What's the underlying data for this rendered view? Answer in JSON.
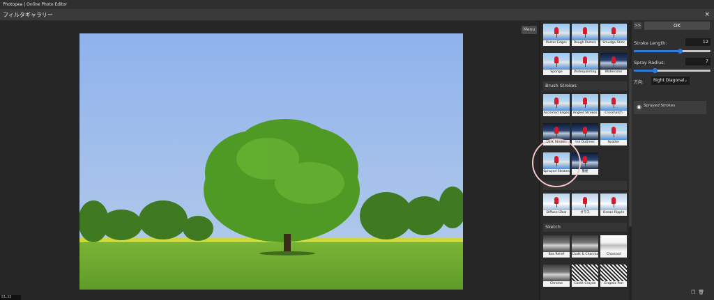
{
  "window": {
    "app_title": "Photopea | Online Photo Editor",
    "dialog_title": "フィルタギャラリー",
    "close_label": "×"
  },
  "preview": {
    "menu_label": "Menu",
    "status_text": "51.33"
  },
  "gallery": {
    "categories": [
      {
        "name": "",
        "items": [
          {
            "label": "Poster Edges",
            "style": "blue"
          },
          {
            "label": "Rough Pastels",
            "style": "blue"
          },
          {
            "label": "Smudge Stick",
            "style": "blue"
          },
          {
            "label": "Sponge",
            "style": "blue"
          },
          {
            "label": "Underpainting",
            "style": "blue"
          },
          {
            "label": "Watercolor",
            "style": "dark"
          }
        ]
      },
      {
        "name": "Brush Strokes",
        "items": [
          {
            "label": "Accented Edges",
            "style": "blue"
          },
          {
            "label": "Angled Strokes",
            "style": "blue"
          },
          {
            "label": "Crosshatch",
            "style": "blue"
          },
          {
            "label": "Dark Strokes",
            "style": "dark"
          },
          {
            "label": "Ink Outlines",
            "style": "dark"
          },
          {
            "label": "Spatter",
            "style": "blue"
          },
          {
            "label": "Sprayed Strokes",
            "style": "blue"
          },
          {
            "label": "墨絵",
            "style": "dark"
          }
        ]
      },
      {
        "name": "",
        "items": [
          {
            "label": "Diffuse Glow",
            "style": "ice"
          },
          {
            "label": "ガラス",
            "style": "ice"
          },
          {
            "label": "Ocean Ripple",
            "style": "ice"
          }
        ]
      },
      {
        "name": "Sketch",
        "items": [
          {
            "label": "Bas Relief",
            "style": "gray"
          },
          {
            "label": "Chalk & Charcoal",
            "style": "gray"
          },
          {
            "label": "Charcoal",
            "style": "white"
          },
          {
            "label": "Chrome",
            "style": "gray"
          },
          {
            "label": "Conté Crayon",
            "style": "noise"
          },
          {
            "label": "Graphic Pen",
            "style": "noise"
          }
        ]
      }
    ]
  },
  "controls": {
    "ff_label": ">>",
    "ok_label": "OK",
    "stroke_length": {
      "label": "Stroke Length:",
      "value": "12",
      "fraction": 0.6
    },
    "spray_radius": {
      "label": "Spray Radius:",
      "value": "7",
      "fraction": 0.28
    },
    "direction": {
      "label": "方向:",
      "value": "Right Diagonal"
    },
    "layer": {
      "name": "Sprayed Strokes"
    }
  },
  "icons": {
    "eye": "eye-icon",
    "new_layer": "new-layer-icon",
    "trash": "trash-icon"
  },
  "colors": {
    "accent": "#2f7bd8",
    "highlight_ring": "#f2c6c6"
  }
}
